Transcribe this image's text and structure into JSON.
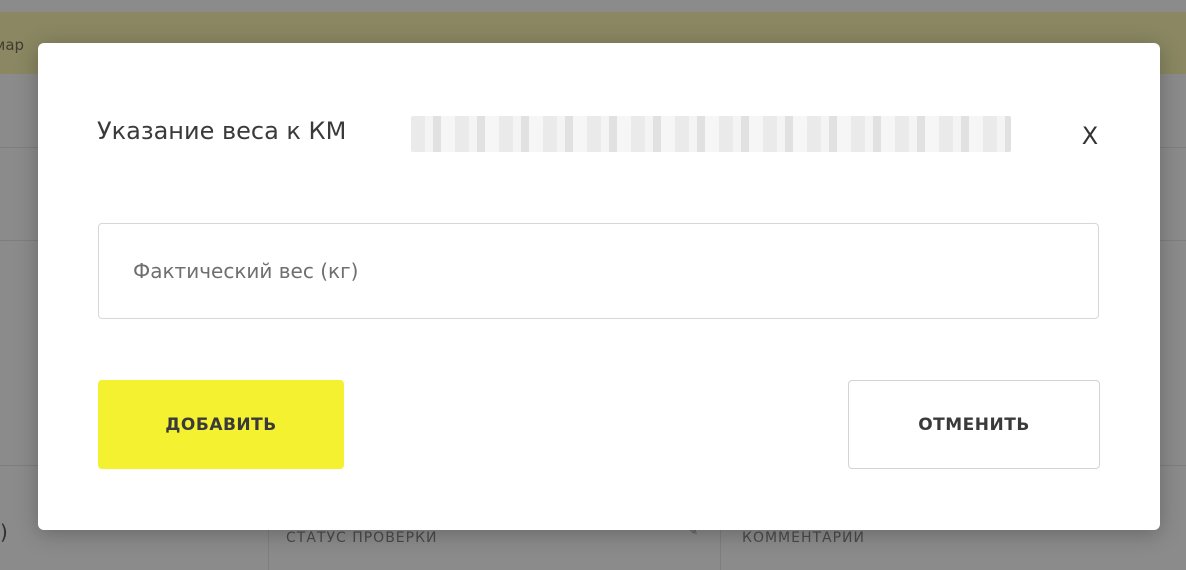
{
  "background": {
    "banner_text": "мар",
    "cell_left_text": ")",
    "cell_status_header": "СТАТУС ПРОВЕРКИ",
    "cell_comments_header": "КОММЕНТАРИИ"
  },
  "modal": {
    "title": "Указание веса к КМ",
    "close_label": "X",
    "weight_input": {
      "placeholder": "Фактический вес (кг)",
      "value": ""
    },
    "add_button_label": "ДОБАВИТЬ",
    "cancel_button_label": "ОТМЕНИТЬ"
  },
  "colors": {
    "add_button": "#f4f130",
    "overlay": "#8b8b8b"
  }
}
